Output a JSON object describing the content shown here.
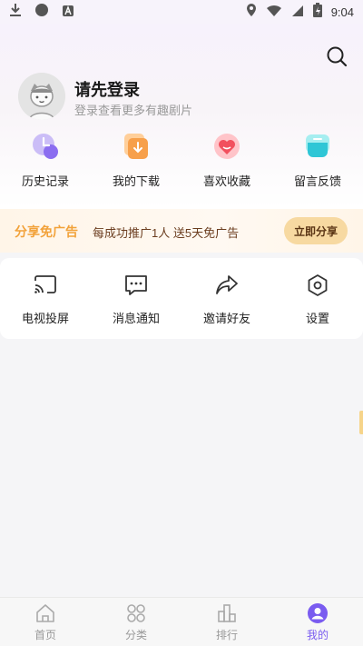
{
  "status_bar": {
    "time": "9:04"
  },
  "profile": {
    "title": "请先登录",
    "subtitle": "登录查看更多有趣剧片"
  },
  "quick_actions": [
    {
      "label": "历史记录",
      "icon": "history-icon"
    },
    {
      "label": "我的下载",
      "icon": "download-icon"
    },
    {
      "label": "喜欢收藏",
      "icon": "favorite-icon"
    },
    {
      "label": "留言反馈",
      "icon": "feedback-icon"
    }
  ],
  "banner": {
    "tag": "分享免广告",
    "text": "每成功推广1人 送5天免广告",
    "button": "立即分享"
  },
  "tools": [
    {
      "label": "电视投屏",
      "icon": "cast-icon"
    },
    {
      "label": "消息通知",
      "icon": "message-icon"
    },
    {
      "label": "邀请好友",
      "icon": "share-icon"
    },
    {
      "label": "设置",
      "icon": "settings-icon"
    }
  ],
  "tab_bar": {
    "tabs": [
      {
        "label": "首页",
        "icon": "home-icon"
      },
      {
        "label": "分类",
        "icon": "category-icon"
      },
      {
        "label": "排行",
        "icon": "ranking-icon"
      },
      {
        "label": "我的",
        "icon": "profile-icon"
      }
    ],
    "active_index": 3
  },
  "colors": {
    "accent": "#7a5cf0",
    "banner_tag": "#f2a23a",
    "share_button": "#f7d9a1"
  }
}
